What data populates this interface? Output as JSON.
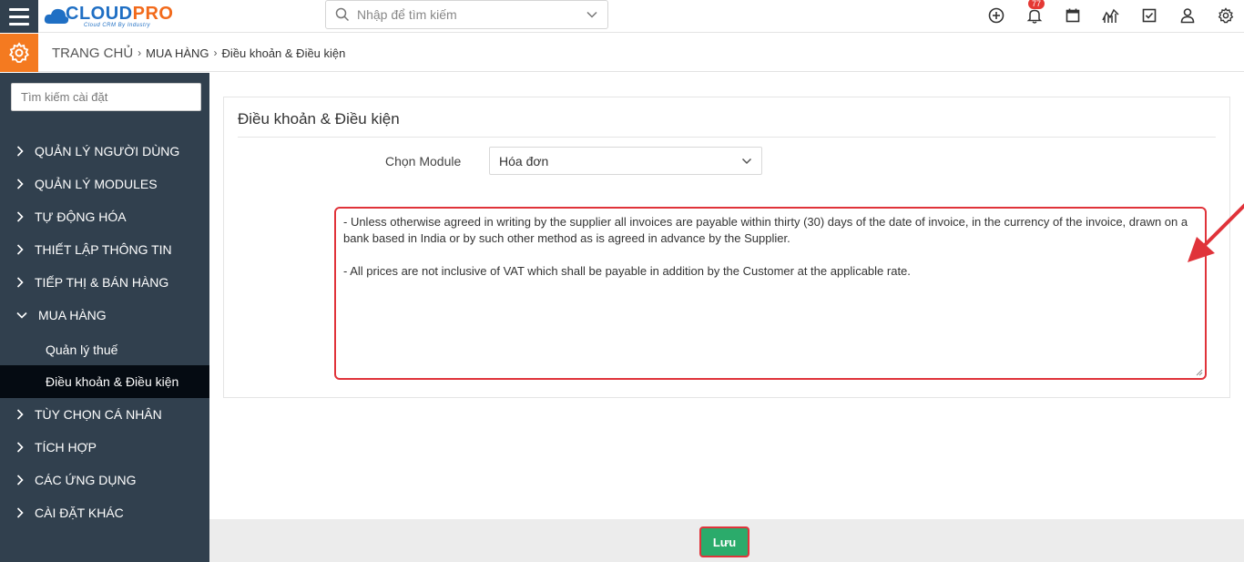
{
  "header": {
    "logo": {
      "cloud": "CLOUD",
      "pro": "PRO",
      "tagline": "Cloud CRM By Industry"
    },
    "search": {
      "placeholder": "Nhập để tìm kiếm"
    },
    "notifications": {
      "count": "77"
    },
    "icons": [
      "plus-circle-icon",
      "bell-icon",
      "calendar-icon",
      "chart-icon",
      "checkbox-icon",
      "user-icon",
      "gear-icon"
    ]
  },
  "breadcrumb": {
    "home": "TRANG CHỦ",
    "level1": "MUA HÀNG",
    "level2": "Điều khoản & Điều kiện"
  },
  "sidebar": {
    "search_placeholder": "Tìm kiếm cài đặt",
    "items": [
      {
        "label": "QUẢN LÝ NGƯỜI DÙNG"
      },
      {
        "label": "QUẢN LÝ MODULES"
      },
      {
        "label": "TỰ ĐỘNG HÓA"
      },
      {
        "label": "THIẾT LẬP THÔNG TIN"
      },
      {
        "label": "TIẾP THỊ & BÁN HÀNG"
      },
      {
        "label": "MUA HÀNG"
      },
      {
        "label": "TÙY CHỌN CÁ NHÂN"
      },
      {
        "label": "TÍCH HỢP"
      },
      {
        "label": "CÁC ỨNG DỤNG"
      },
      {
        "label": "CÀI ĐẶT KHÁC"
      }
    ],
    "subitems": [
      {
        "label": "Quản lý thuế"
      },
      {
        "label": "Điều khoản & Điều kiện"
      }
    ]
  },
  "main": {
    "title": "Điều khoản & Điều kiện",
    "module_label": "Chọn Module",
    "module_value": "Hóa đơn",
    "terms_line1": " - Unless otherwise agreed in writing by the supplier all invoices are payable within thirty (30) days of the date of invoice, in the currency of the invoice, drawn on a bank based in India or by such other method as is agreed in advance by the Supplier.",
    "terms_line2": " - All prices are not inclusive of VAT which shall be payable in addition by the Customer at the applicable rate."
  },
  "footer": {
    "save_label": "Lưu"
  },
  "colors": {
    "sidebar": "#31404e",
    "accent_orange": "#f47a20",
    "save_green": "#2bab6b",
    "highlight_red": "#e0333a"
  }
}
